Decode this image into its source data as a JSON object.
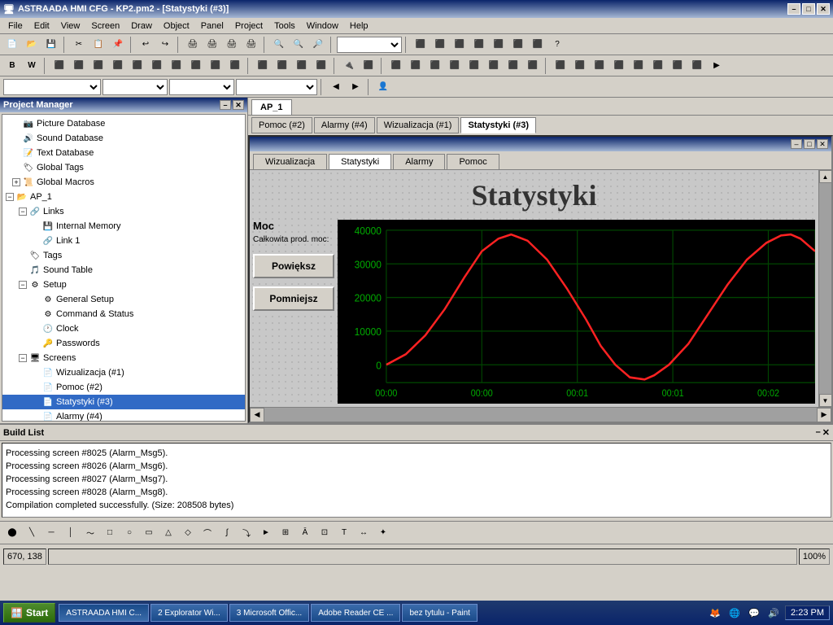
{
  "titlebar": {
    "title": "ASTRAADA HMI CFG - KP2.pm2 - [Statystyki (#3)]",
    "min": "–",
    "max": "□",
    "close": "✕"
  },
  "menu": {
    "items": [
      "File",
      "Edit",
      "View",
      "Screen",
      "Draw",
      "Object",
      "Panel",
      "Project",
      "Tools",
      "Window",
      "Help"
    ]
  },
  "project_manager": {
    "title": "Project Manager",
    "tree": [
      {
        "id": "picture-db",
        "label": "Picture Database",
        "indent": 12,
        "icon": "📁",
        "expandable": false
      },
      {
        "id": "sound-db",
        "label": "Sound Database",
        "indent": 12,
        "icon": "📁",
        "expandable": false
      },
      {
        "id": "text-db",
        "label": "Text Database",
        "indent": 12,
        "icon": "📁",
        "expandable": false
      },
      {
        "id": "global-tags",
        "label": "Global Tags",
        "indent": 12,
        "icon": "📁",
        "expandable": false
      },
      {
        "id": "global-macros",
        "label": "Global Macros",
        "indent": 12,
        "icon": "📁",
        "expandable": true,
        "expanded": false
      },
      {
        "id": "ap1",
        "label": "AP_1",
        "indent": 4,
        "icon": "📂",
        "expandable": true,
        "expanded": true
      },
      {
        "id": "links",
        "label": "Links",
        "indent": 20,
        "icon": "🔗",
        "expandable": true,
        "expanded": true
      },
      {
        "id": "internal-memory",
        "label": "Internal Memory",
        "indent": 36,
        "icon": "💾",
        "expandable": false
      },
      {
        "id": "link1",
        "label": "Link 1",
        "indent": 36,
        "icon": "🔗",
        "expandable": false
      },
      {
        "id": "tags",
        "label": "Tags",
        "indent": 20,
        "icon": "🏷",
        "expandable": false
      },
      {
        "id": "sound-table",
        "label": "Sound Table",
        "indent": 20,
        "icon": "🔊",
        "expandable": false
      },
      {
        "id": "setup",
        "label": "Setup",
        "indent": 20,
        "icon": "⚙",
        "expandable": true,
        "expanded": true
      },
      {
        "id": "general-setup",
        "label": "General Setup",
        "indent": 36,
        "icon": "⚙",
        "expandable": false
      },
      {
        "id": "command-status",
        "label": "Command & Status",
        "indent": 36,
        "icon": "⚙",
        "expandable": false
      },
      {
        "id": "clock",
        "label": "Clock",
        "indent": 36,
        "icon": "🕐",
        "expandable": false
      },
      {
        "id": "passwords",
        "label": "Passwords",
        "indent": 36,
        "icon": "🔑",
        "expandable": false
      },
      {
        "id": "screens",
        "label": "Screens",
        "indent": 20,
        "icon": "📺",
        "expandable": true,
        "expanded": true
      },
      {
        "id": "wizualizacja",
        "label": "Wizualizacja (#1)",
        "indent": 36,
        "icon": "📄",
        "expandable": false
      },
      {
        "id": "pomoc",
        "label": "Pomoc (#2)",
        "indent": 36,
        "icon": "📄",
        "expandable": false
      },
      {
        "id": "statystyki",
        "label": "Statystyki (#3)",
        "indent": 36,
        "icon": "📄",
        "expandable": false
      },
      {
        "id": "alarmy",
        "label": "Alarmy (#4)",
        "indent": 36,
        "icon": "📄",
        "expandable": false
      }
    ]
  },
  "ap_tab": {
    "label": "AP_1"
  },
  "screen_tabs": [
    {
      "id": "pomoc",
      "label": "Pomoc (#2)"
    },
    {
      "id": "alarmy",
      "label": "Alarmy (#4)"
    },
    {
      "id": "wizualizacja",
      "label": "Wizualizacja (#1)"
    },
    {
      "id": "statystyki",
      "label": "Statystyki (#3)",
      "active": true
    }
  ],
  "inner_tabs": [
    {
      "id": "wizualizacja",
      "label": "Wizualizacja"
    },
    {
      "id": "statystyki",
      "label": "Statystyki",
      "active": true
    },
    {
      "id": "alarmy",
      "label": "Alarmy"
    },
    {
      "id": "pomoc",
      "label": "Pomoc"
    }
  ],
  "statystyki": {
    "title": "Statystyki",
    "moc_label": "Moc",
    "calkowita_label": "Całkowita prod. moc:",
    "btn_powieksz": "Powiększ",
    "btn_pomniejsz": "Pomniejsz",
    "chart": {
      "y_labels": [
        "40000",
        "30000",
        "20000",
        "10000",
        "0"
      ],
      "x_labels": [
        "00:00",
        "00:00",
        "00:01",
        "00:01",
        "00:02"
      ],
      "grid_color": "#004400",
      "line_color": "#ff2222"
    }
  },
  "inner_controls": {
    "min": "–",
    "restore": "□",
    "close": "✕"
  },
  "build_list": {
    "title": "Build List",
    "lines": [
      "Processing screen #8025 (Alarm_Msg5).",
      "Processing screen #8026 (Alarm_Msg6).",
      "Processing screen #8027 (Alarm_Msg7).",
      "Processing screen #8028 (Alarm_Msg8).",
      "",
      "Compilation completed successfully. (Size: 208508 bytes)"
    ]
  },
  "statusbar": {
    "coords": "670, 138",
    "zoom": "100%"
  },
  "taskbar": {
    "start_label": "Start",
    "items": [
      {
        "id": "astraada",
        "label": "ASTRAADA HMI C...",
        "active": true
      },
      {
        "id": "explorer",
        "label": "2 Explorator Wi..."
      },
      {
        "id": "office",
        "label": "3 Microsoft Offic..."
      },
      {
        "id": "adobe",
        "label": "Adobe Reader CE ..."
      },
      {
        "id": "paint",
        "label": "bez tytulu - Paint"
      }
    ],
    "clock": "2:23 PM"
  },
  "bottom_toolbar": {
    "items": [
      "⬤",
      "╲",
      "─",
      "│",
      "〜",
      "□",
      "○",
      "▭",
      "△",
      "◇",
      "⌒",
      "∫",
      "⤵",
      "►",
      "⊞",
      "Ā",
      "⊡",
      "T",
      "↔",
      "✦"
    ]
  }
}
